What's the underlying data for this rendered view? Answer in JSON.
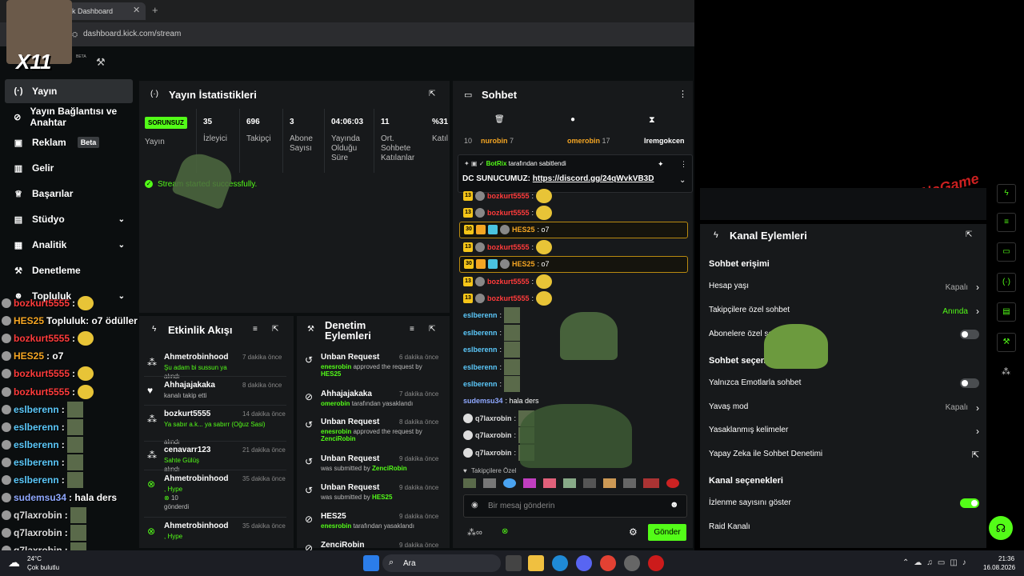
{
  "browser": {
    "tab_title": "k Dashboard",
    "tab_close": "✕",
    "new_tab": "+",
    "url": "dashboard.kick.com/stream"
  },
  "stream_overlay": {
    "cam_tag": "X11",
    "beta_tag": "BETA"
  },
  "sidebar": {
    "items": [
      {
        "label": "Yayın",
        "icon": "broadcast-icon",
        "active": true
      },
      {
        "label": "Yayın Bağlantısı ve Anahtar",
        "icon": "link-icon"
      },
      {
        "label": "Reklam",
        "icon": "ad-icon",
        "badge": "Beta"
      },
      {
        "label": "Gelir",
        "icon": "chart-icon"
      },
      {
        "label": "Başarılar",
        "icon": "trophy-icon"
      },
      {
        "label": "Stüdyo",
        "icon": "studio-icon",
        "chevron": "⌄"
      },
      {
        "label": "Analitik",
        "icon": "analytics-icon",
        "chevron": "⌄"
      },
      {
        "label": "Denetleme",
        "icon": "wrench-icon"
      },
      {
        "label": "Topluluk",
        "icon": "community-icon",
        "chevron": "⌄"
      }
    ]
  },
  "stats": {
    "title": "Yayın İstatistikleri",
    "status": "SORUNSUZ",
    "status_label": "Yayın",
    "items": [
      {
        "value": "35",
        "label": "İzleyici"
      },
      {
        "value": "696",
        "label": "Takipçi"
      },
      {
        "value": "3",
        "label": "Abone Sayısı"
      },
      {
        "value": "04:06:03",
        "label": "Yayında Olduğu Süre"
      },
      {
        "value": "11",
        "label": "Ort. Sohbete Katılanlar"
      },
      {
        "value": "%31",
        "label": "Katıl"
      }
    ],
    "message": "Stream started successfully."
  },
  "activity": {
    "title": "Etkinlik Akışı",
    "events": [
      {
        "user": "Ahmetrobinhood",
        "time": "7 dakika önce",
        "detail_green": "Şu adam bi sussun ya",
        "detail": "alındı",
        "icon": "points-icon"
      },
      {
        "user": "Ahhajajakaka",
        "time": "8 dakika önce",
        "detail": "kanalı takip etti",
        "icon": "heart-icon"
      },
      {
        "user": "bozkurt5555",
        "time": "14 dakika önce",
        "detail_green": "Ya sabır a.k... ya sabırr (Oğuz Sasi)",
        "detail": "alındı",
        "icon": "points-icon"
      },
      {
        "user": "cenavarr123",
        "time": "21 dakika önce",
        "detail_green": "Sahte Gülüş",
        "detail": "alındı",
        "icon": "points-icon"
      },
      {
        "user": "Ahmetrobinhood",
        "time": "35 dakika önce",
        "detail_green": ", Hype",
        "gift_count": "10",
        "detail": "gönderdi",
        "icon": "kick-icon"
      },
      {
        "user": "Ahmetrobinhood",
        "time": "35 dakika önce",
        "detail_green": ", Hype",
        "icon": "kick-icon"
      }
    ]
  },
  "moderation": {
    "title": "Denetim Eylemleri",
    "actions": [
      {
        "title": "Unban Request",
        "time": "6 dakika önce",
        "actor": "enesrobin",
        "text": "approved the request by",
        "target": "HES25",
        "icon": "undo-icon"
      },
      {
        "title": "Ahhajajakaka",
        "time": "7 dakika önce",
        "actor": "omerobin",
        "text": "tarafından yasaklandı",
        "icon": "ban-icon"
      },
      {
        "title": "Unban Request",
        "time": "8 dakika önce",
        "actor": "enesrobin",
        "text": "approved the request by",
        "target": "ZenciRobin",
        "icon": "undo-icon"
      },
      {
        "title": "Unban Request",
        "time": "9 dakika önce",
        "text": "was submitted by",
        "target": "ZenciRobin",
        "icon": "undo-icon"
      },
      {
        "title": "Unban Request",
        "time": "9 dakika önce",
        "text": "was submitted by",
        "target": "HES25",
        "icon": "undo-icon"
      },
      {
        "title": "HES25",
        "time": "9 dakika önce",
        "actor": "enesrobin",
        "text": "tarafından yasaklandı",
        "icon": "ban-icon"
      },
      {
        "title": "ZenciRobin",
        "time": "9 dakika önce",
        "icon": "ban-icon"
      }
    ]
  },
  "chat": {
    "title": "Sohbet",
    "leaderboard": [
      {
        "rank": "10"
      },
      {
        "name": "nurobin",
        "count": "7"
      },
      {
        "name": "omerobin",
        "count": "17"
      },
      {
        "name": "Iremgokcen"
      }
    ],
    "pinned": {
      "author": "BotRix",
      "by_text": "tarafından sabitlendi",
      "text": "DC SUNUCUMUZ:",
      "link": "https://discord.gg/24qWvkVB3D"
    },
    "messages": [
      {
        "user": "bozkurt5555",
        "color": "#ff3b3b",
        "text": ":",
        "badge": "13"
      },
      {
        "user": "bozkurt5555",
        "color": "#ff3b3b",
        "text": ":",
        "badge": "13"
      },
      {
        "user": "HES25",
        "color": "#f5a623",
        "text": ": o7",
        "badge": "30",
        "highlight": true
      },
      {
        "user": "bozkurt5555",
        "color": "#ff3b3b",
        "text": ":",
        "badge": "13"
      },
      {
        "user": "HES25",
        "color": "#f5a623",
        "text": ": o7",
        "badge": "30",
        "highlight": true
      },
      {
        "user": "bozkurt5555",
        "color": "#ff3b3b",
        "text": ":",
        "badge": "13"
      },
      {
        "user": "bozkurt5555",
        "color": "#ff3b3b",
        "text": ":",
        "badge": "13"
      },
      {
        "user": "eslberenn",
        "color": "#5bc8fa",
        "text": ":"
      },
      {
        "user": "eslberenn",
        "color": "#5bc8fa",
        "text": ":"
      },
      {
        "user": "eslberenn",
        "color": "#5bc8fa",
        "text": ":"
      },
      {
        "user": "eslberenn",
        "color": "#5bc8fa",
        "text": ":"
      },
      {
        "user": "eslberenn",
        "color": "#5bc8fa",
        "text": ":"
      },
      {
        "user": "sudemsu34",
        "color": "#8fa8ff",
        "text": ": hala ders"
      },
      {
        "user": "q7laxrobin",
        "color": "#ddd",
        "text": ":"
      },
      {
        "user": "q7laxrobin",
        "color": "#ddd",
        "text": ":"
      },
      {
        "user": "q7laxrobin",
        "color": "#ddd",
        "text": ":"
      }
    ],
    "followers_label": "Takipçilere Özel",
    "input_placeholder": "Bir mesaj gönderin",
    "send": "Gönder"
  },
  "overlay_chat": [
    {
      "user": "bozkurt5555",
      "color": "#ff3b3b",
      "text": ":"
    },
    {
      "user": "HES25",
      "color": "#f5a623",
      "text": "Topluluk: o7 ödüller"
    },
    {
      "user": "bozkurt5555",
      "color": "#ff3b3b",
      "text": ":"
    },
    {
      "user": "HES25",
      "color": "#f5a623",
      "text": ": o7"
    },
    {
      "user": "bozkurt5555",
      "color": "#ff3b3b",
      "text": ":"
    },
    {
      "user": "bozkurt5555",
      "color": "#ff3b3b",
      "text": ":"
    },
    {
      "user": "eslberenn",
      "color": "#5bc8fa",
      "text": ":"
    },
    {
      "user": "eslberenn",
      "color": "#5bc8fa",
      "text": ":"
    },
    {
      "user": "eslberenn",
      "color": "#5bc8fa",
      "text": ":"
    },
    {
      "user": "eslberenn",
      "color": "#5bc8fa",
      "text": ":"
    },
    {
      "user": "eslberenn",
      "color": "#5bc8fa",
      "text": ":"
    },
    {
      "user": "sudemsu34",
      "color": "#8fa8ff",
      "text": ": hala ders"
    },
    {
      "user": "q7laxrobin",
      "color": "#ddd",
      "text": ":"
    },
    {
      "user": "q7laxrobin",
      "color": "#ddd",
      "text": ":"
    },
    {
      "user": "q7laxrobin",
      "color": "#ddd",
      "text": ":"
    }
  ],
  "channel_actions": {
    "title": "Kanal Eylemleri",
    "chat_access": "Sohbet erişimi",
    "rows": [
      {
        "label": "Hesap yaşı",
        "value": "Kapalı",
        "type": "chevron"
      },
      {
        "label": "Takipçilere özel sohbet",
        "value": "Anında",
        "type": "chevron",
        "green": true
      },
      {
        "label": "Abonelere özel sohbet",
        "type": "toggle",
        "on": false
      }
    ],
    "chat_options": "Sohbet seçenekleri",
    "rows2": [
      {
        "label": "Yalnızca Emotlarla sohbet",
        "type": "toggle",
        "on": false
      },
      {
        "label": "Yavaş mod",
        "value": "Kapalı",
        "type": "chevron"
      },
      {
        "label": "Yasaklanmış kelimeler",
        "type": "chevron"
      },
      {
        "label": "Yapay Zeka ile Sohbet Denetimi",
        "type": "external"
      }
    ],
    "channel_options": "Kanal seçenekleri",
    "rows3": [
      {
        "label": "İzlenme sayısını göster",
        "type": "toggle",
        "on": true
      },
      {
        "label": "Raid Kanalı",
        "type": "none"
      }
    ]
  },
  "watermark": "ByNoGame",
  "taskbar": {
    "weather_temp": "24°C",
    "weather_desc": "Çok bulutlu",
    "search": "Ara",
    "time": "21:36",
    "date": "16.08.2026"
  }
}
